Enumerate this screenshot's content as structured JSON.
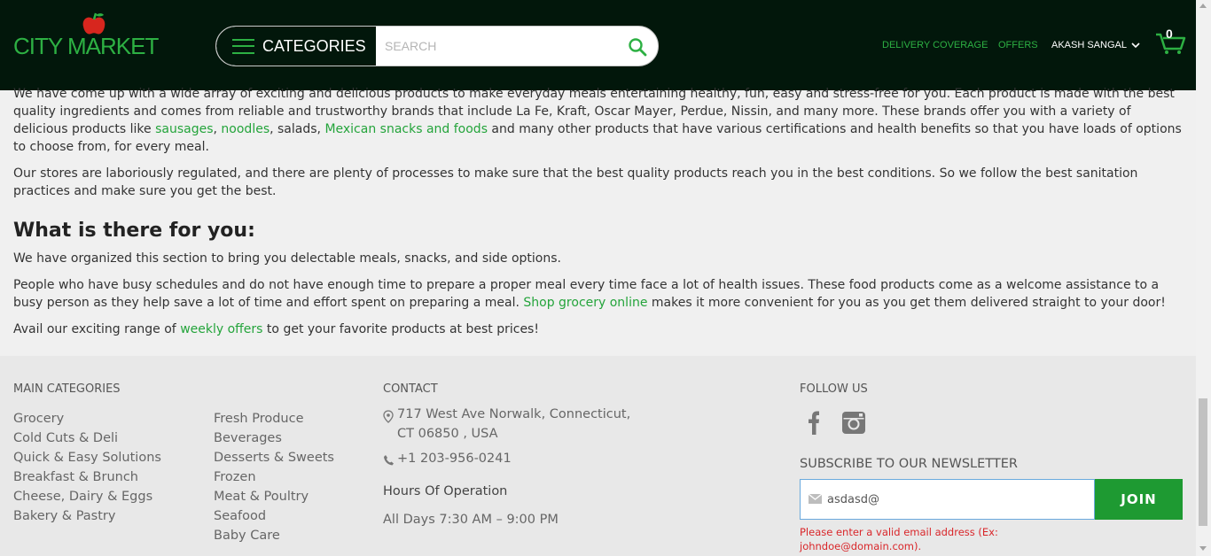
{
  "header": {
    "logo_text": "CITY MARKET",
    "categories_label": "CATEGORIES",
    "search_placeholder": "SEARCH",
    "nav": {
      "delivery": "DELIVERY COVERAGE",
      "offers": "OFFERS",
      "user": "AKASH SANGAL"
    },
    "cart_count": "0"
  },
  "article": {
    "p1": {
      "t1": "We have come up with a wide array of exciting and delicious products to make everyday meals entertaining healthy, fun, easy and stress-free for you. Each product is made with the best quality ingredients and comes from reliable and trustworthy brands that include La Fe, Kraft, Oscar Mayer, Perdue, Nissin, and many more. These brands offer you with a variety of delicious products like ",
      "link1": "sausages",
      "sep1": ", ",
      "link2": "noodles",
      "t2": ", salads, ",
      "link3": "Mexican snacks and foods",
      "t3": " and many other products that have various certifications and health benefits so that you have loads of options to choose from, for every meal."
    },
    "p2": "Our stores are laboriously regulated, and there are plenty of processes to make sure that the best quality products reach you in the best conditions. So we follow the best sanitation practices and make sure you get the best.",
    "heading": "What is there for you:",
    "p3": "We have organized this section to bring you delectable meals, snacks, and side options.",
    "p4": {
      "t1": "People who have busy schedules and do not have enough time to prepare a proper meal every time face a lot of health issues. These food products come as a welcome assistance to a busy person as they help save a lot of time and effort spent on preparing a meal. ",
      "link": "Shop grocery online",
      "t2": " makes it more convenient for you as you get them delivered straight to your door!"
    },
    "p5": {
      "t1": "Avail our exciting range of ",
      "link": "weekly offers",
      "t2": " to get your favorite products at best prices!"
    }
  },
  "footer": {
    "main_categories_title": "MAIN CATEGORIES",
    "col1": [
      "Grocery",
      "Cold Cuts & Deli",
      "Quick & Easy Solutions",
      "Breakfast & Brunch",
      "Cheese, Dairy & Eggs",
      "Bakery & Pastry"
    ],
    "col2": [
      "Fresh Produce",
      "Beverages",
      "Desserts & Sweets",
      "Frozen",
      "Meat & Poultry",
      "Seafood",
      "Baby Care"
    ],
    "contact_title": "CONTACT",
    "address_line1": "717 West Ave Norwalk, Connecticut,",
    "address_line2": "CT 06850 , USA",
    "phone": "+1 203-956-0241",
    "hours_title": "Hours Of Operation",
    "hours": "All Days 7:30 AM – 9:00 PM",
    "follow_title": "FOLLOW US",
    "newsletter_title": "SUBSCRIBE TO OUR NEWSLETTER",
    "email_value": "asdasd@",
    "join_label": "JOIN",
    "error": "Please enter a valid email address (Ex: johndoe@domain.com)."
  },
  "colors": {
    "header_bg": "#02170b",
    "accent_green": "#2db043",
    "link_green": "#24a43b",
    "join_green": "#1e9a32",
    "error_red": "#d9262a",
    "apple_red": "#d7261e"
  },
  "icons": [
    "apple-icon",
    "hamburger-icon",
    "search-icon",
    "chevron-down-icon",
    "cart-icon",
    "location-pin-icon",
    "phone-icon",
    "facebook-icon",
    "instagram-icon",
    "mail-icon"
  ]
}
